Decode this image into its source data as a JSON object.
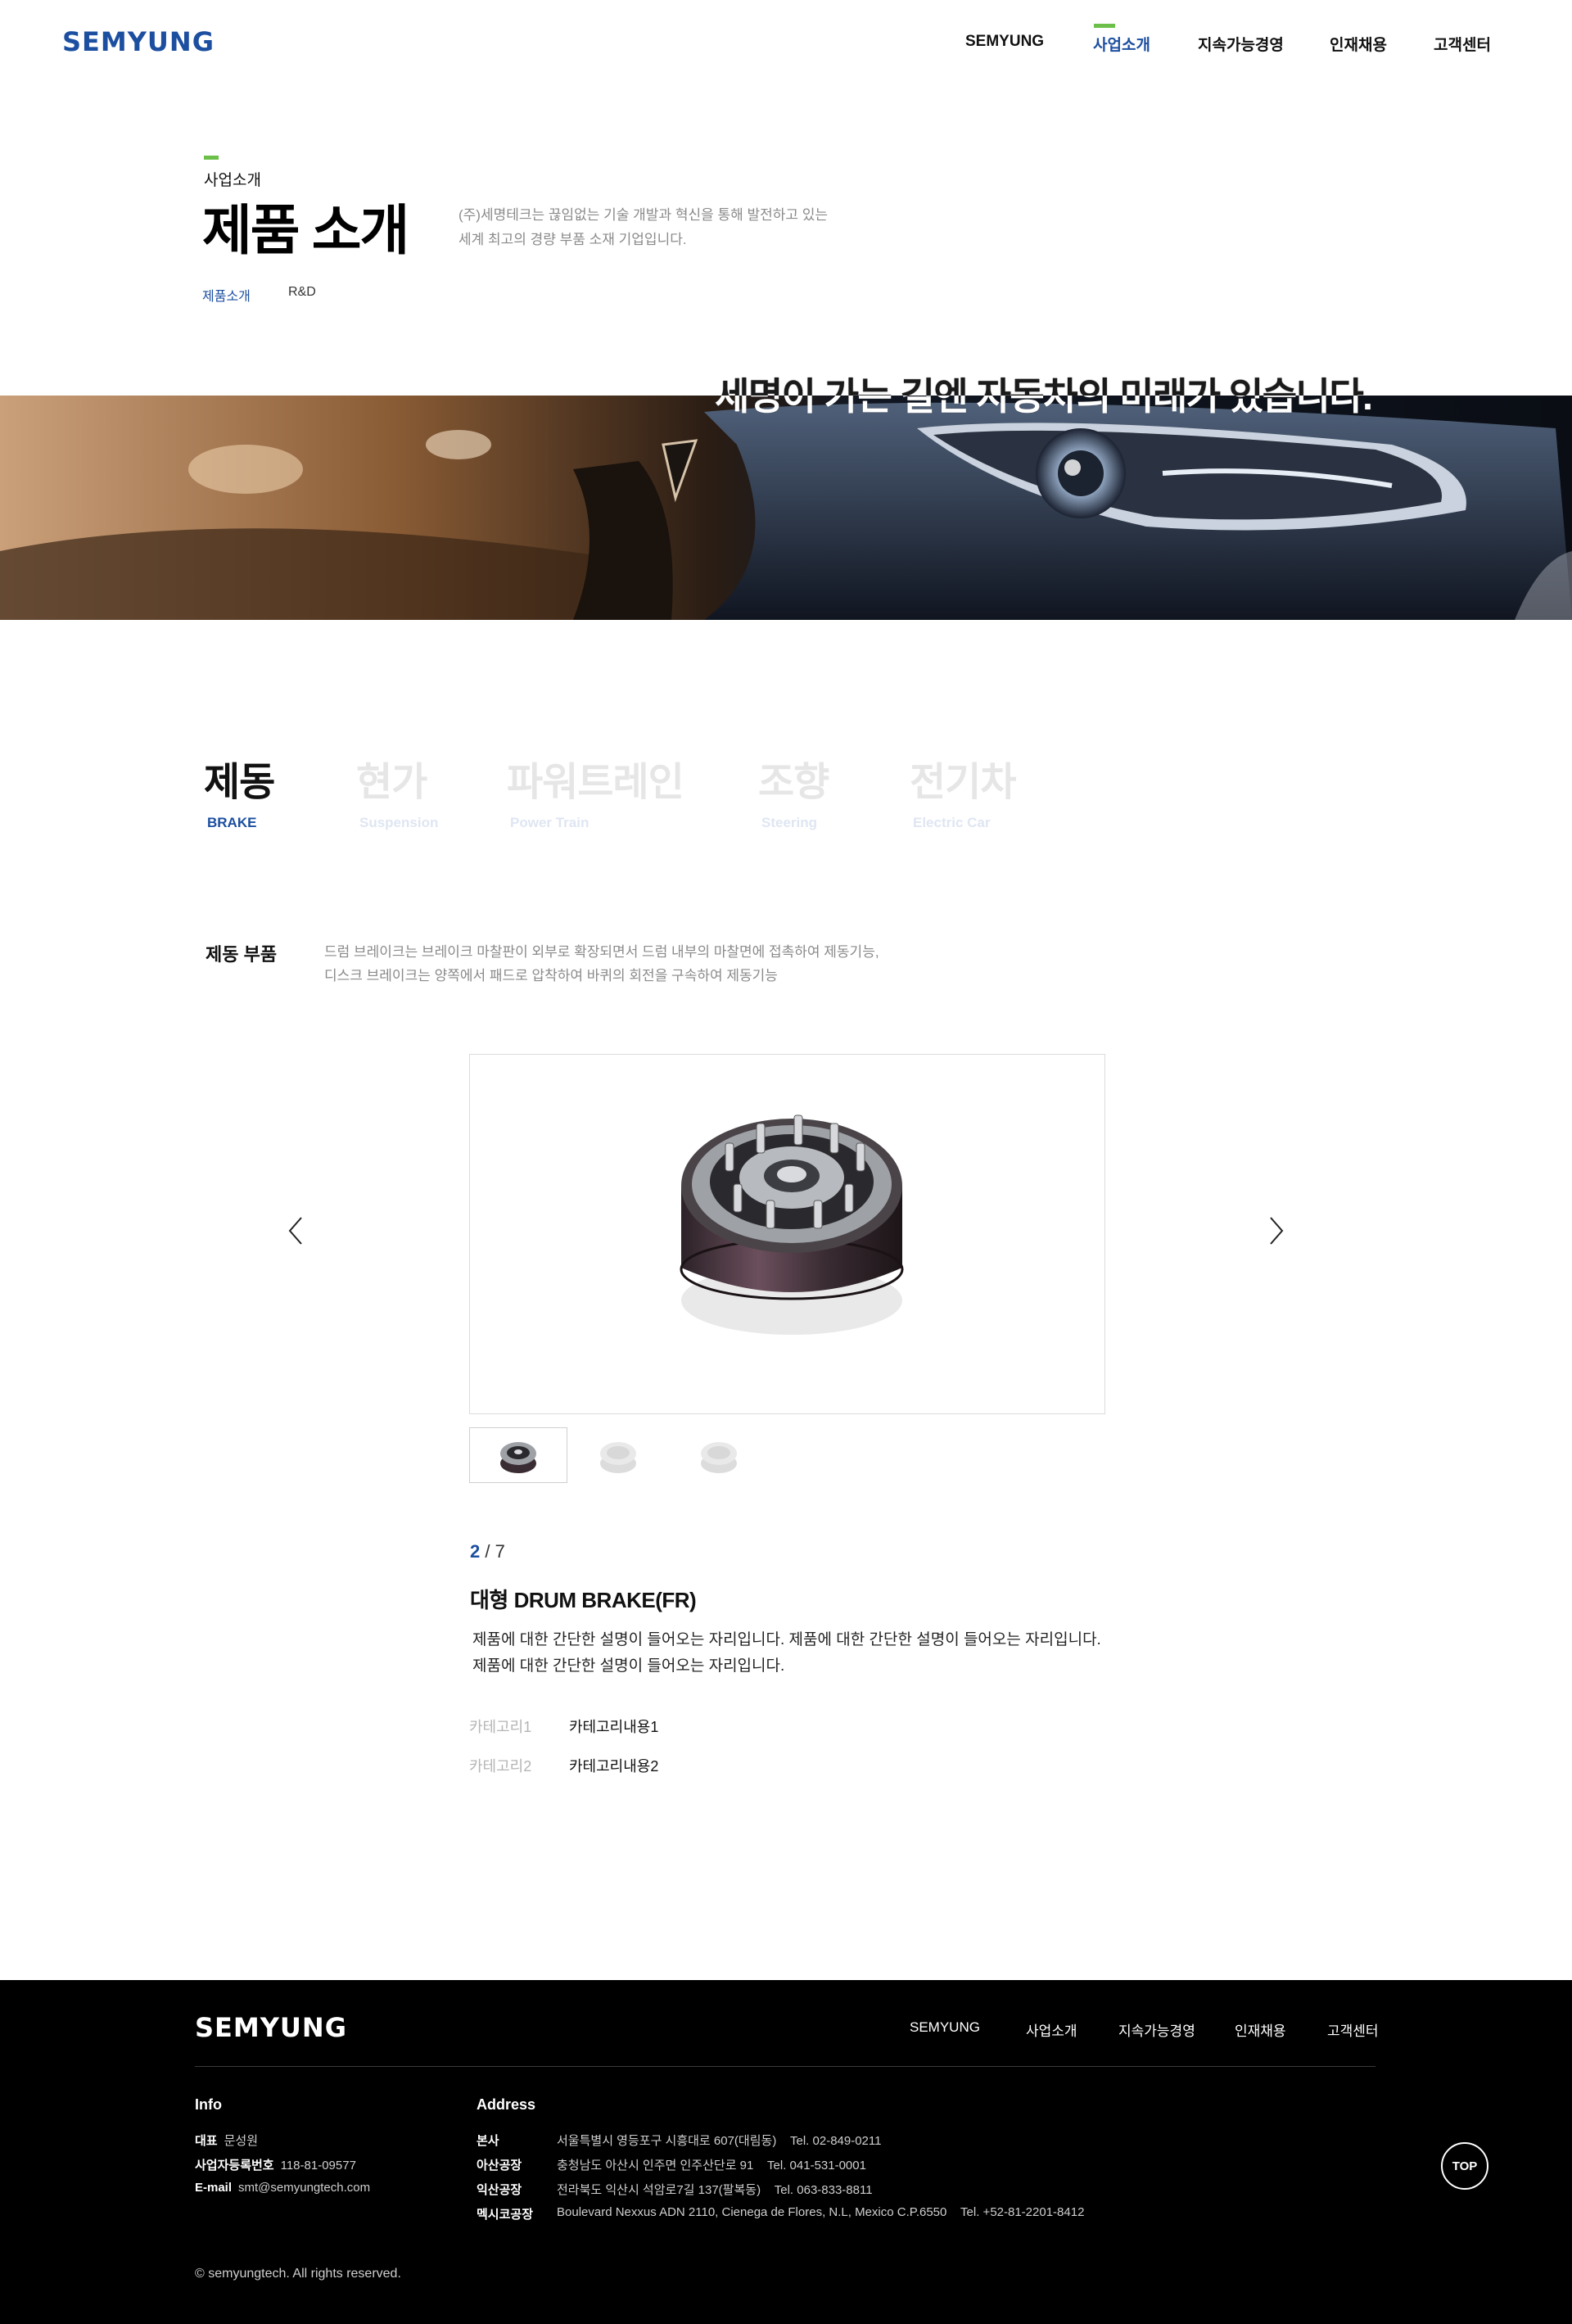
{
  "header": {
    "logo": "SEMYUNG",
    "nav": [
      "SEMYUNG",
      "사업소개",
      "지속가능경영",
      "인재채용",
      "고객센터"
    ],
    "active_nav": "사업소개"
  },
  "page_head": {
    "eyebrow": "사업소개",
    "title": "제품 소개",
    "desc_line1": "(주)세명테크는 끊임없는 기술 개발과 혁신을 통해 발전하고 있는",
    "desc_line2": "세계 최고의 경량 부품 소재 기업입니다.",
    "subtabs": [
      "제품소개",
      "R&D"
    ]
  },
  "banner": {
    "text": "세명이 가는 길엔 자동차의 미래가 있습니다."
  },
  "categories": [
    {
      "ko": "제동",
      "en": "BRAKE"
    },
    {
      "ko": "현가",
      "en": "Suspension"
    },
    {
      "ko": "파워트레인",
      "en": "Power Train"
    },
    {
      "ko": "조향",
      "en": "Steering"
    },
    {
      "ko": "전기차",
      "en": "Electric Car"
    }
  ],
  "section": {
    "title": "제동 부품",
    "desc_line1": "드럼 브레이크는 브레이크 마찰판이 외부로 확장되면서 드럼 내부의 마찰면에 접촉하여 제동기능,",
    "desc_line2": "디스크 브레이크는 양쪽에서 패드로 압착하여 바퀴의 회전을 구속하여 제동기능"
  },
  "product": {
    "current": "2",
    "total": "/ 7",
    "name": "대형 DRUM BRAKE(FR)",
    "desc": "제품에 대한 간단한 설명이 들어오는 자리입니다. 제품에 대한 간단한 설명이 들어오는 자리입니다. 제품에 대한 간단한 설명이 들어오는 자리입니다.",
    "specs": [
      {
        "label": "카테고리1",
        "value": "카테고리내용1"
      },
      {
        "label": "카테고리2",
        "value": "카테고리내용2"
      }
    ]
  },
  "footer": {
    "logo": "SEMYUNG",
    "nav": [
      "SEMYUNG",
      "사업소개",
      "지속가능경영",
      "인재채용",
      "고객센터"
    ],
    "info_title": "Info",
    "ceo_label": "대표",
    "ceo": "문성원",
    "bizno_label": "사업자등록번호",
    "bizno": "118-81-09577",
    "email_label": "E-mail",
    "email": "smt@semyungtech.com",
    "address_title": "Address",
    "addresses": [
      {
        "label": "본사",
        "addr": "서울특별시 영등포구 시흥대로 607(대림동)",
        "tel": "Tel. 02-849-0211"
      },
      {
        "label": "아산공장",
        "addr": "충청남도 아산시 인주면 인주산단로 91",
        "tel": "Tel. 041-531-0001"
      },
      {
        "label": "익산공장",
        "addr": "전라북도 익산시 석암로7길 137(팔복동)",
        "tel": "Tel. 063-833-8811"
      },
      {
        "label": "멕시코공장",
        "addr": "Boulevard Nexxus ADN 2110, Cienega de Flores, N.L, Mexico C.P.6550",
        "tel": "Tel. +52-81-2201-8412"
      }
    ],
    "copyright": "© semyungtech. All rights reserved.",
    "top_button": "TOP"
  }
}
